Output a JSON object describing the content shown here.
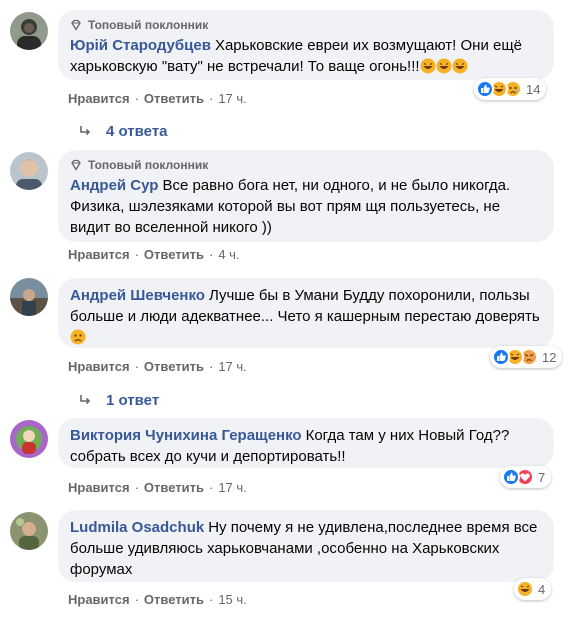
{
  "comments": [
    {
      "badge": "Топовый поклонник",
      "author": "Юрій Стародубцев",
      "text": "Харьковские евреи их возмущают! Они ещё харьковскую \"вату\" не встречали! То ваще огонь!!!",
      "like_label": "Нравится",
      "reply_label": "Ответить",
      "time": "17 ч.",
      "reactions": {
        "types": [
          "like",
          "haha",
          "sad"
        ],
        "count": "14"
      },
      "replies_label": "4 ответа"
    },
    {
      "badge": "Топовый поклонник",
      "author": "Андрей Сур",
      "text": "Все равно бога нет, ни одного, и не было никогда. Физика, шэлезяками которой вы вот прям щя пользуетесь, не видит во вселенной никого ))",
      "like_label": "Нравится",
      "reply_label": "Ответить",
      "time": "4 ч."
    },
    {
      "author": "Андрей Шевченко",
      "text": "Лучше бы в Умани Будду похоронили, пользы больше и люди адекватнее... Чето я кашерным перестаю доверять",
      "like_label": "Нравится",
      "reply_label": "Ответить",
      "time": "17 ч.",
      "reactions": {
        "types": [
          "like",
          "haha",
          "angry"
        ],
        "count": "12"
      },
      "replies_label": "1 ответ"
    },
    {
      "author": "Виктория Чунихина Геращенко",
      "text": "Когда там у них Новый Год?? собрать всех до кучи и депортировать!!",
      "like_label": "Нравится",
      "reply_label": "Ответить",
      "time": "17 ч.",
      "reactions": {
        "types": [
          "like",
          "love"
        ],
        "count": "7"
      }
    },
    {
      "author": "Ludmila Osadchuk",
      "text": "Ну почему я не удивлена,последнее время все больше удивляюсь харьковчанами ,особенно на Харьковских форумах",
      "like_label": "Нравится",
      "reply_label": "Ответить",
      "time": "15 ч.",
      "reactions": {
        "types": [
          "haha"
        ],
        "count": "4"
      }
    }
  ],
  "colors": {
    "link": "#385898",
    "bubble": "#f0f2f5",
    "muted": "#65676b",
    "like": "#1877f2",
    "love": "#f33e58",
    "haha": "#f7b125"
  }
}
